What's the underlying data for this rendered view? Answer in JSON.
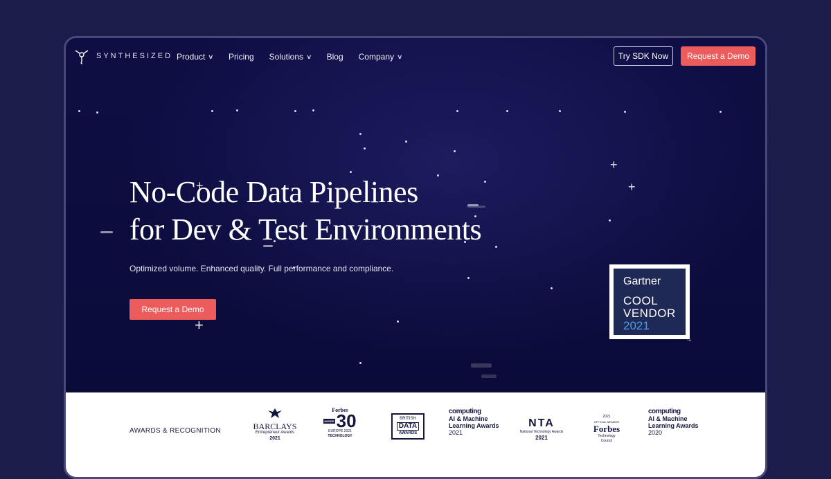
{
  "nav": {
    "logo_text": "SYNTHESIZED",
    "items": [
      {
        "label": "Product",
        "dropdown": true
      },
      {
        "label": "Pricing",
        "dropdown": false
      },
      {
        "label": "Solutions",
        "dropdown": true
      },
      {
        "label": "Blog",
        "dropdown": false
      },
      {
        "label": "Company",
        "dropdown": true
      }
    ],
    "try_sdk": "Try SDK Now",
    "request_demo": "Request a Demo"
  },
  "hero": {
    "headline_line1": "No-Code Data Pipelines",
    "headline_line2": "for Dev & Test Environments",
    "subtitle": "Optimized volume. Enhanced quality. Full performance and compliance.",
    "cta": "Request a Demo"
  },
  "gartner": {
    "brand": "Gartner",
    "line1": "COOL",
    "line2": "VENDOR",
    "year": "2021",
    "tm": "TM"
  },
  "awards": {
    "label": "AWARDS & RECOGNITION",
    "barclays": {
      "name": "BARCLAYS",
      "sub": "Entrepreneur Awards",
      "year": "2021"
    },
    "forbes30": {
      "brand": "Forbes",
      "under": "UNDER",
      "num": "30",
      "line1": "EUROPE 2021",
      "line2": "TECHNOLOGY"
    },
    "bda": {
      "line1": "BRITISH",
      "line2": "DATA",
      "line3": "AWARDS"
    },
    "computing2021": {
      "brand": "computing",
      "line1": "AI & Machine",
      "line2": "Learning Awards",
      "year": "2021"
    },
    "nta": {
      "name": "NTA",
      "sub": "National Technology Awards",
      "year": "2021"
    },
    "forbes_council": {
      "year": "2021",
      "official": "OFFICIAL MEMBER",
      "brand": "Forbes",
      "line1": "Technology",
      "line2": "Council"
    },
    "computing2020": {
      "brand": "computing",
      "line1": "AI & Machine",
      "line2": "Learning Awards",
      "year": "2020"
    }
  },
  "colors": {
    "background": "#1c1c4b",
    "hero": "#0d0d42",
    "accent": "#ec5c5c",
    "gartner_blue": "#4c9be8"
  }
}
